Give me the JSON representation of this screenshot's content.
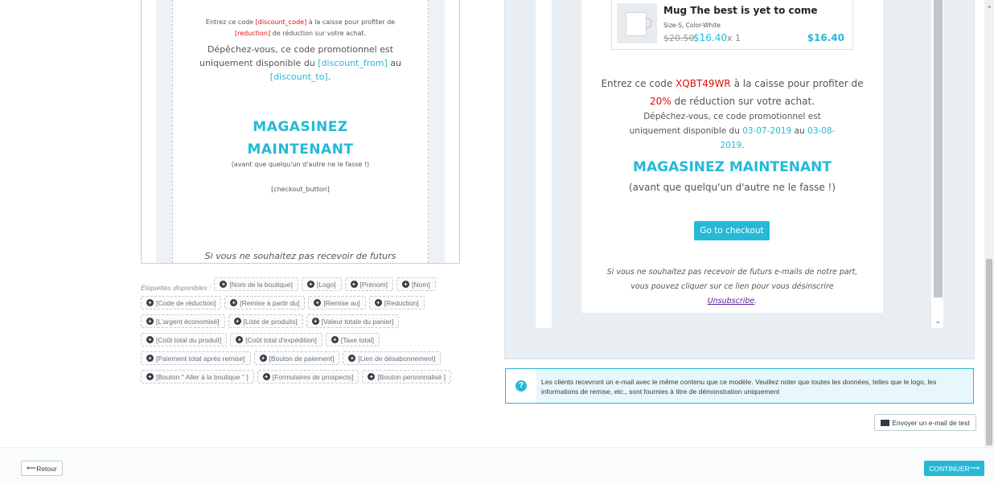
{
  "editor": {
    "line1_a": "Entrez ce code ",
    "line1_code": "[discount_code]",
    "line1_b": " à la caisse pour profiter de",
    "line1_reduction": "[reduction]",
    "line1_c": " de réduction sur votre achat.",
    "line2_a": "Dépêchez-vous, ce code promotionnel est uniquement disponible du ",
    "line2_from": "[discount_from]",
    "line2_b": " au",
    "line2_to": "[discount_to]",
    "line2_c": ".",
    "shop_line1": "MAGASINEZ",
    "shop_line2": "MAINTENANT",
    "before_other": "(avant que quelqu'un d'autre ne le fasse !)",
    "checkout_tag": "[checkout_button]",
    "unsub": "Si vous ne souhaitez pas recevoir de futurs"
  },
  "tags": {
    "label": "Étiquettes disponibles :",
    "items": [
      "[Nom de la boutique]",
      "[Logo]",
      "[Prénom]",
      "[Nom]",
      "[Code de réduction]",
      "[Remise à partir du]",
      "[Remise au]",
      "[Reduction]",
      "[L'argent économisé]",
      "[Liste de produits]",
      "[Valeur totale du panier]",
      "[Coût total du produit]",
      "[Coût total d'expédition]",
      "[Taxe total]",
      "[Paiement total après remise]",
      "[Bouton de paiement]",
      "[Lien de désabonnement]",
      "[Bouton \" Aller à la boutique \" ]",
      "[Formulaires de prospects]",
      "[Bouton personnalisé ]"
    ]
  },
  "preview": {
    "product_name": "Mug The best is yet to come",
    "product_attr": "Size-S, Color-White",
    "old_price": "$20.50",
    "new_price": "$16.40",
    "qty": "x 1",
    "total": "$16.40",
    "line1_a": "Entrez ce code ",
    "code": "XQBT49WR",
    "line1_b": " à la caisse pour profiter de",
    "percent": "20%",
    "line1_c": " de réduction sur votre achat.",
    "line2_a": "Dépêchez-vous, ce code promotionnel est uniquement disponible du ",
    "from": "03-07-2019",
    "line2_b": " au ",
    "to": "03-08-2019",
    "line2_c": ".",
    "shop": "MAGASINEZ MAINTENANT",
    "before_other": "(avant que quelqu'un d'autre ne le fasse !)",
    "checkout_btn": "Go to checkout",
    "unsub_a": "Si vous ne souhaitez pas recevoir de futurs e-mails de notre part, vous pouvez cliquer sur ce lien pour vous désinscrire ",
    "unsub_link": "Unsubscribe",
    "unsub_b": "."
  },
  "alert": {
    "icon": "?",
    "text": "Les clients recevront un e-mail avec le même contenu que ce modèle. Veuillez noter que toutes les données, telles que le logo, les informations de remise, etc., sont fournies à titre de démonstration uniquement"
  },
  "actions": {
    "send_test": "Envoyer un e-mail de test",
    "back": "Retour",
    "back_arrow": "⟵",
    "continue": "CONTINUER",
    "continue_arrow": "⟶"
  },
  "colors": {
    "accent": "#25b9d7",
    "code_red": "#e30b0b"
  }
}
